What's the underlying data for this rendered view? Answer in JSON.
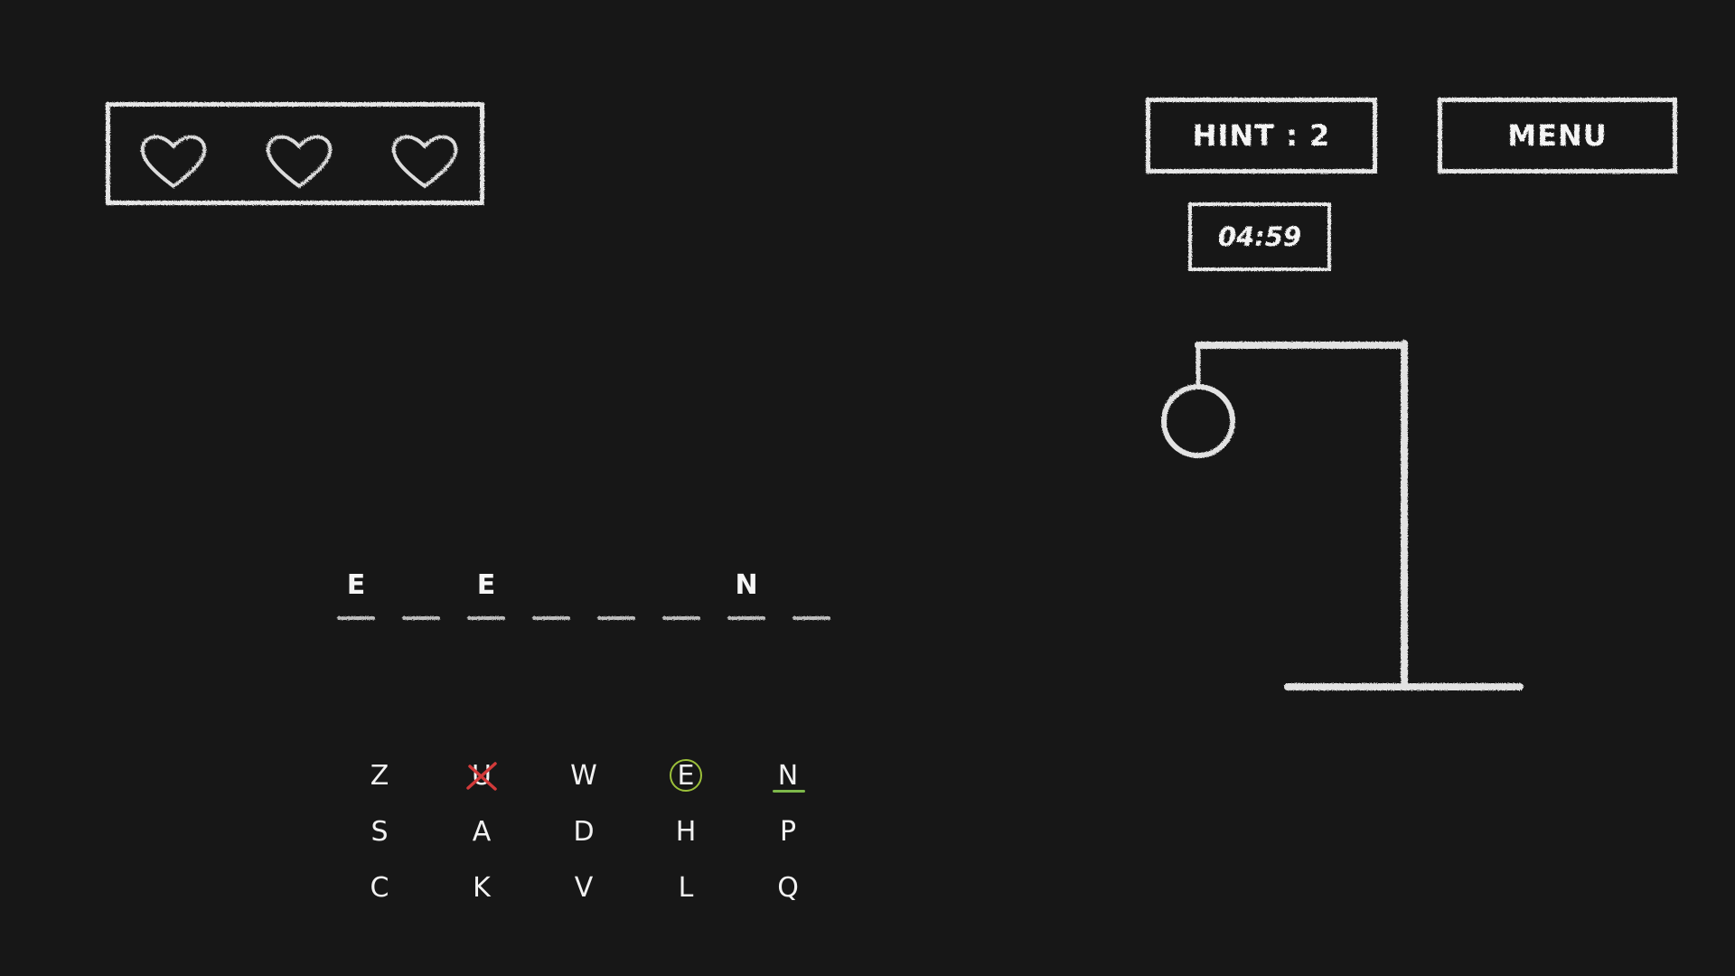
{
  "lives": {
    "count": 3,
    "icons": [
      "heart-icon",
      "heart-icon",
      "heart-icon"
    ]
  },
  "header": {
    "hint_label": "HINT : 2",
    "menu_label": "MENU",
    "timer": "04:59"
  },
  "word": {
    "slots": [
      "E",
      "",
      "E",
      "",
      "",
      "",
      "N",
      ""
    ]
  },
  "keyboard": {
    "rows": [
      [
        "Z",
        "U",
        "W",
        "E",
        "N"
      ],
      [
        "S",
        "A",
        "D",
        "H",
        "P"
      ],
      [
        "C",
        "K",
        "V",
        "L",
        "Q"
      ]
    ],
    "wrong": [
      "U"
    ],
    "correct": [
      "E",
      "N"
    ]
  },
  "colors": {
    "background": "#171717",
    "chalk": "#e6e6e6",
    "wrong_mark": "#d23a3a",
    "correct_circle": "#9bbf3a",
    "correct_underline": "#7db84a"
  }
}
